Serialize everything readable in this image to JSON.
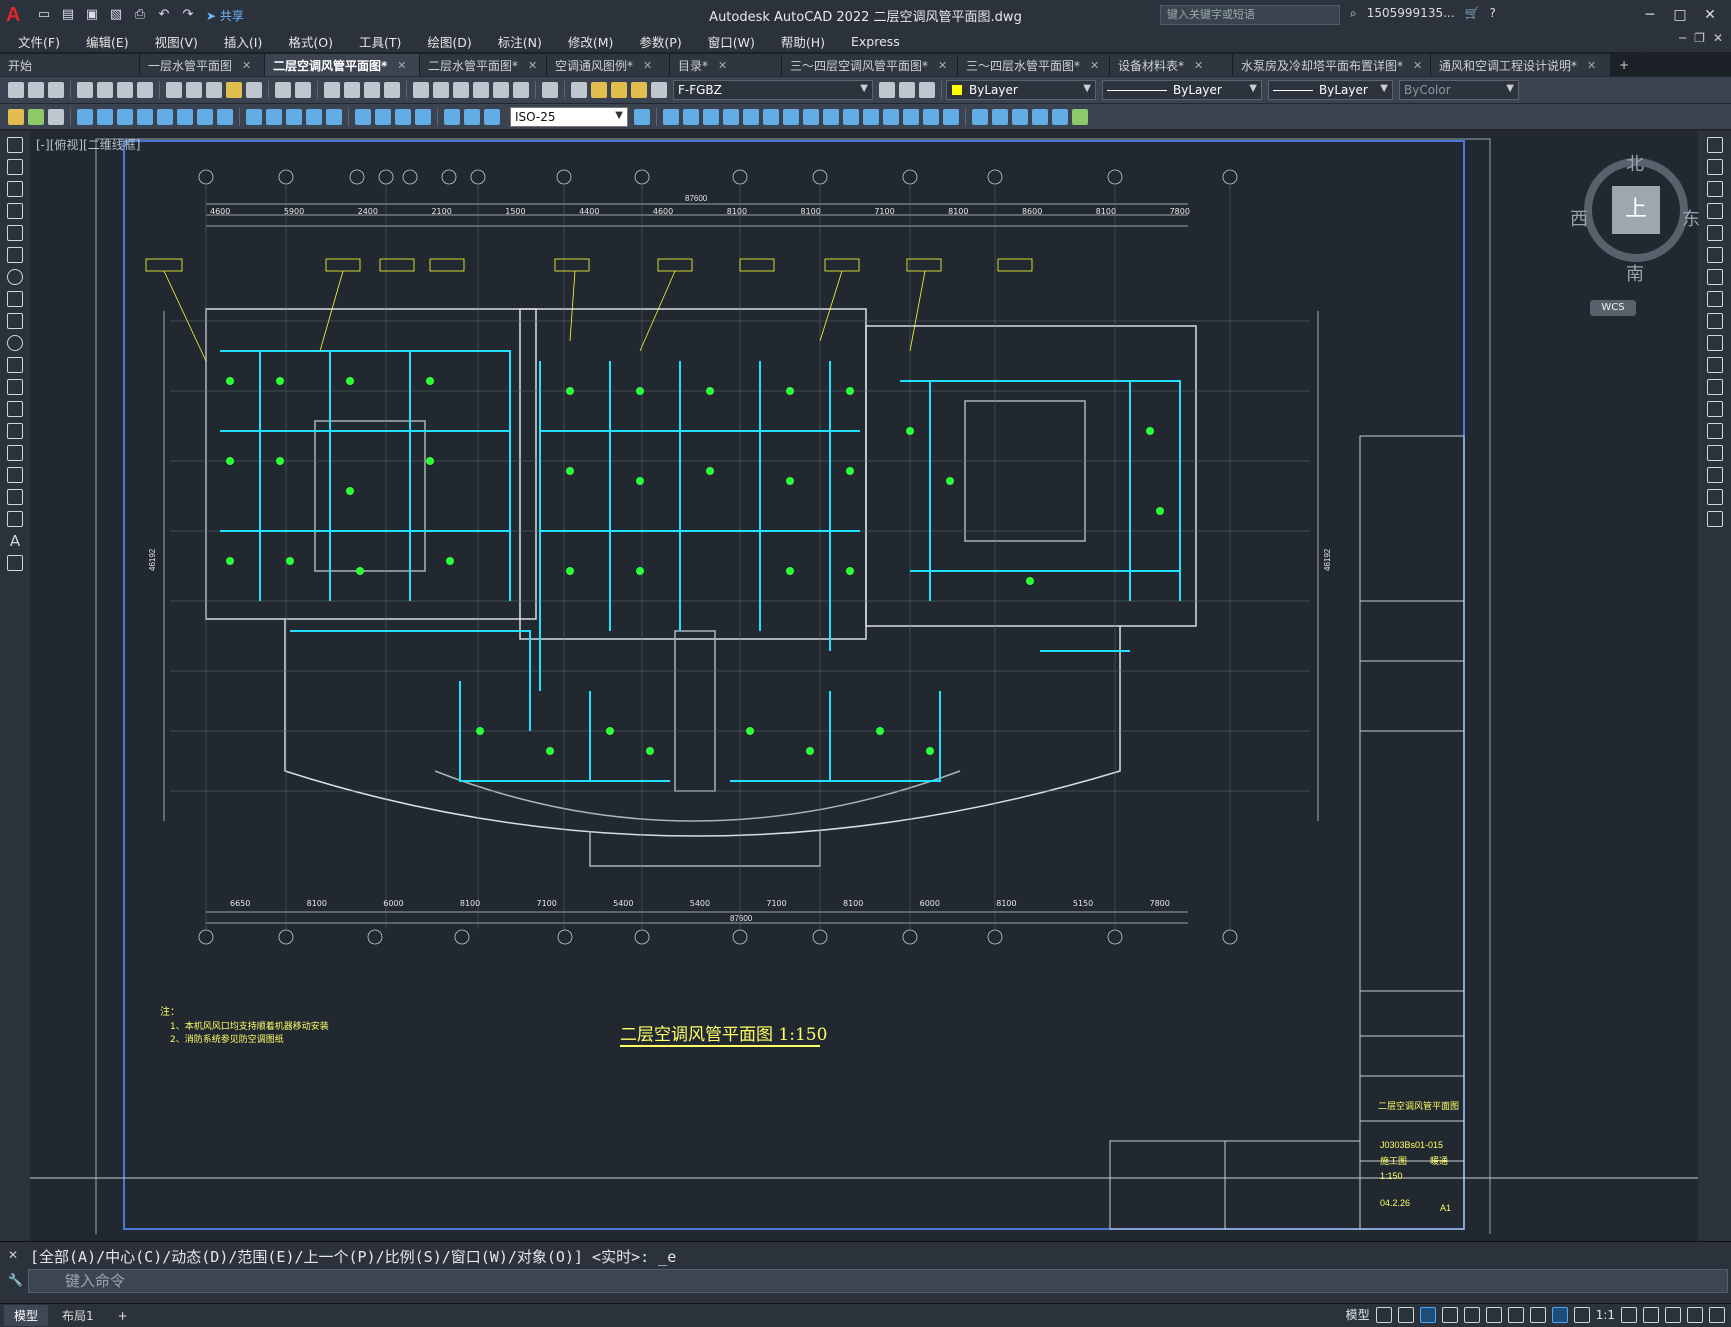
{
  "app": {
    "title": "Autodesk AutoCAD 2022    二层空调风管平面图.dwg",
    "share_label": "共享",
    "search_placeholder": "键入关键字或短语",
    "user": "1505999135...",
    "window_controls": [
      "─",
      "□",
      "✕"
    ]
  },
  "menu": [
    "文件(F)",
    "编辑(E)",
    "视图(V)",
    "插入(I)",
    "格式(O)",
    "工具(T)",
    "绘图(D)",
    "标注(N)",
    "修改(M)",
    "参数(P)",
    "窗口(W)",
    "帮助(H)",
    "Express"
  ],
  "tabs": [
    {
      "label": "开始",
      "closable": false
    },
    {
      "label": "一层水管平面图",
      "closable": true
    },
    {
      "label": "二层空调风管平面图*",
      "closable": true,
      "active": true
    },
    {
      "label": "二层水管平面图*",
      "closable": true
    },
    {
      "label": "空调通风图例*",
      "closable": true
    },
    {
      "label": "目录*",
      "closable": true
    },
    {
      "label": "三～四层空调风管平面图*",
      "closable": true
    },
    {
      "label": "三～四层水管平面图*",
      "closable": true
    },
    {
      "label": "设备材料表*",
      "closable": true
    },
    {
      "label": "水泵房及冷却塔平面布置详图*",
      "closable": true
    },
    {
      "label": "通风和空调工程设计说明*",
      "closable": true
    }
  ],
  "toolbar": {
    "layer": "F-FGBZ",
    "color": "ByLayer",
    "linetype": "ByLayer",
    "lineweight": "ByLayer",
    "plotstyle": "ByColor",
    "dimstyle": "ISO-25"
  },
  "viewport_label": "[-][俯视][二维线框]",
  "viewcube": {
    "north": "北",
    "south": "南",
    "east": "东",
    "west": "西",
    "face": "上",
    "wcs": "WCS"
  },
  "drawing": {
    "title": "二层空调风管平面图  1:150",
    "overall_dim": "87600",
    "top_dims": [
      "4600",
      "5900",
      "2400",
      "2100",
      "1500",
      "4400",
      "4600",
      "8100",
      "8100",
      "7100",
      "8100",
      "8600",
      "8100",
      "7800"
    ],
    "bottom_dims": [
      "6650",
      "8100",
      "6000",
      "8100",
      "7100",
      "5400",
      "5400",
      "7100",
      "8100",
      "6000",
      "8100",
      "5150",
      "7800"
    ],
    "notes_title": "注：",
    "notes": [
      "1、本机风风口均支持顺着机器移动安装",
      "2、消防系统参见防空调图纸"
    ],
    "total_height": "46192",
    "title_block": {
      "drawing_name": "二层空调风管平面图",
      "drawing_no": "J0303Bs01-015",
      "scale": "1:150",
      "date": "04.2.26",
      "stage": "施工图",
      "discipline": "暖通",
      "sheet_size": "A1"
    }
  },
  "command": {
    "history": "[全部(A)/中心(C)/动态(D)/范围(E)/上一个(P)/比例(S)/窗口(W)/对象(O)] <实时>: _e",
    "placeholder": "键入命令"
  },
  "status": {
    "layouts": [
      "模型",
      "布局1"
    ],
    "model_label": "模型",
    "scale": "1:1"
  }
}
